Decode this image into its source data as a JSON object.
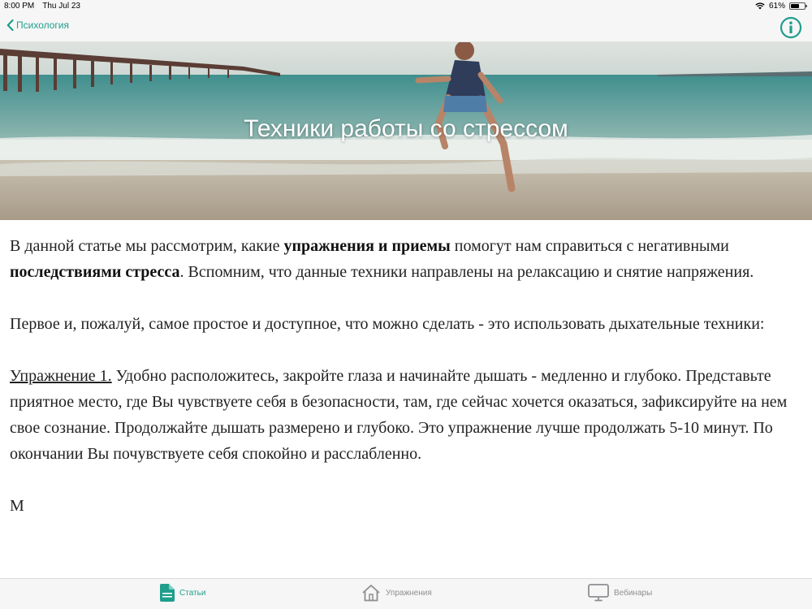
{
  "status_bar": {
    "time": "8:00 PM",
    "date": "Thu Jul 23",
    "battery": "61%",
    "battery_level": 0.61
  },
  "nav": {
    "back_label": "Психология",
    "back_icon": "chevron-left-icon",
    "info_icon": "info-circle-icon"
  },
  "hero": {
    "title": "Техники работы со стрессом"
  },
  "article": {
    "p1": {
      "t1": "В данной статье мы рассмотрим, какие ",
      "b1": "упражнения и приемы",
      "t2": " помогут нам справиться с негативными ",
      "b2": "последствиями стресса",
      "t3": ". Вспомним, что данные техники направлены на релаксацию и снятие напряжения."
    },
    "p2": "Первое и, пожалуй, самое простое и доступное, что можно сделать - это использовать дыхательные техники:",
    "p3": {
      "heading": "Упражнение 1.",
      "text": " Удобно расположитесь, закройте глаза и начинайте дышать - медленно и глубоко. Представьте приятное место, где Вы чувствуете себя в безопасности, там, где сейчас хочется оказаться, зафиксируйте на нем свое сознание. Продолжайте дышать размерено и глубоко. Это упражнение лучше продолжать 5-10 минут. По окончании Вы почувствуете себя спокойно и расслабленно."
    },
    "p4": "М"
  },
  "tabs": [
    {
      "label": "Статьи",
      "icon": "document-icon",
      "active": true
    },
    {
      "label": "Упражнения",
      "icon": "house-icon",
      "active": false
    },
    {
      "label": "Вебинары",
      "icon": "monitor-icon",
      "active": false
    }
  ],
  "colors": {
    "accent": "#1f9e8c",
    "inactive": "#8e8e93"
  }
}
